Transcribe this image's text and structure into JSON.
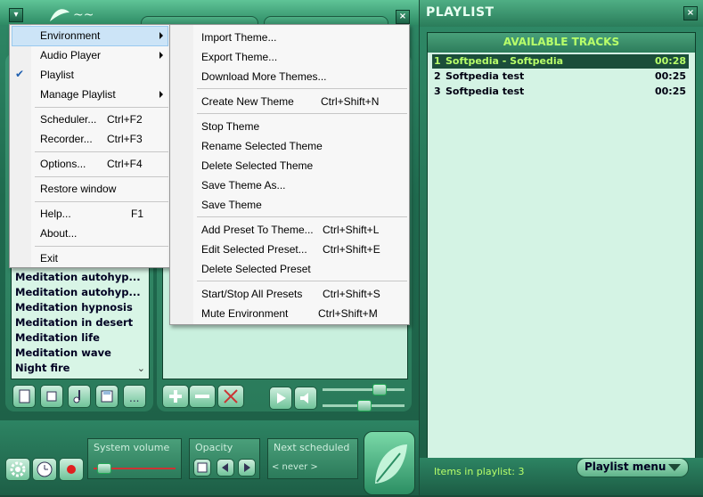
{
  "player": {
    "tracks": [
      "Meditation autohyp...",
      "Meditation autohyp...",
      "Meditation hypnosis",
      "Meditation in desert",
      "Meditation life",
      "Meditation wave",
      "Night fire"
    ],
    "system_volume_label": "System volume",
    "opacity_label": "Opacity",
    "next_scheduled_label": "Next scheduled",
    "next_scheduled_value": "< never >",
    "system_volume_level": 0.08,
    "slider_top_level": 0.72,
    "slider_bottom_level": 0.5
  },
  "menu": {
    "items": [
      {
        "label": "Environment",
        "shortcut": "",
        "submenu": true
      },
      {
        "label": "Audio Player",
        "shortcut": "",
        "submenu": true
      },
      {
        "label": "Playlist",
        "shortcut": "",
        "checked": true
      },
      {
        "label": "Manage Playlist",
        "shortcut": "",
        "submenu": true
      },
      {
        "label": "Scheduler...",
        "shortcut": "Ctrl+F2"
      },
      {
        "label": "Recorder...",
        "shortcut": "Ctrl+F3"
      },
      {
        "label": "Options...",
        "shortcut": "Ctrl+F4"
      },
      {
        "label": "Restore window",
        "shortcut": ""
      },
      {
        "label": "Help...",
        "shortcut": "F1"
      },
      {
        "label": "About...",
        "shortcut": ""
      },
      {
        "label": "Exit",
        "shortcut": ""
      }
    ],
    "highlight_color": "#cce4f7"
  },
  "submenu": {
    "items": [
      {
        "label": "Import Theme...",
        "shortcut": ""
      },
      {
        "label": "Export Theme...",
        "shortcut": ""
      },
      {
        "label": "Download More Themes...",
        "shortcut": ""
      },
      {
        "label": "Create New Theme",
        "shortcut": "Ctrl+Shift+N"
      },
      {
        "label": "Stop Theme",
        "shortcut": ""
      },
      {
        "label": "Rename Selected Theme",
        "shortcut": ""
      },
      {
        "label": "Delete Selected Theme",
        "shortcut": ""
      },
      {
        "label": "Save Theme As...",
        "shortcut": ""
      },
      {
        "label": "Save Theme",
        "shortcut": ""
      },
      {
        "label": "Add Preset To Theme...",
        "shortcut": "Ctrl+Shift+L"
      },
      {
        "label": "Edit Selected Preset...",
        "shortcut": "Ctrl+Shift+E"
      },
      {
        "label": "Delete Selected Preset",
        "shortcut": ""
      },
      {
        "label": "Start/Stop All Presets",
        "shortcut": "Ctrl+Shift+S"
      },
      {
        "label": "Mute Environment",
        "shortcut": "Ctrl+Shift+M"
      }
    ]
  },
  "playlist": {
    "title": "PLAYLIST",
    "header": "AVAILABLE TRACKS",
    "tracks": [
      {
        "num": "1",
        "name": "Softpedia - Softpedia",
        "time": "00:28",
        "selected": true
      },
      {
        "num": "2",
        "name": "Softpedia test",
        "time": "00:25",
        "selected": false
      },
      {
        "num": "3",
        "name": "Softpedia test",
        "time": "00:25",
        "selected": false
      }
    ],
    "items_label": "Items in playlist: 3",
    "menu_button": "Playlist menu",
    "accent": "#b8ff6a"
  }
}
